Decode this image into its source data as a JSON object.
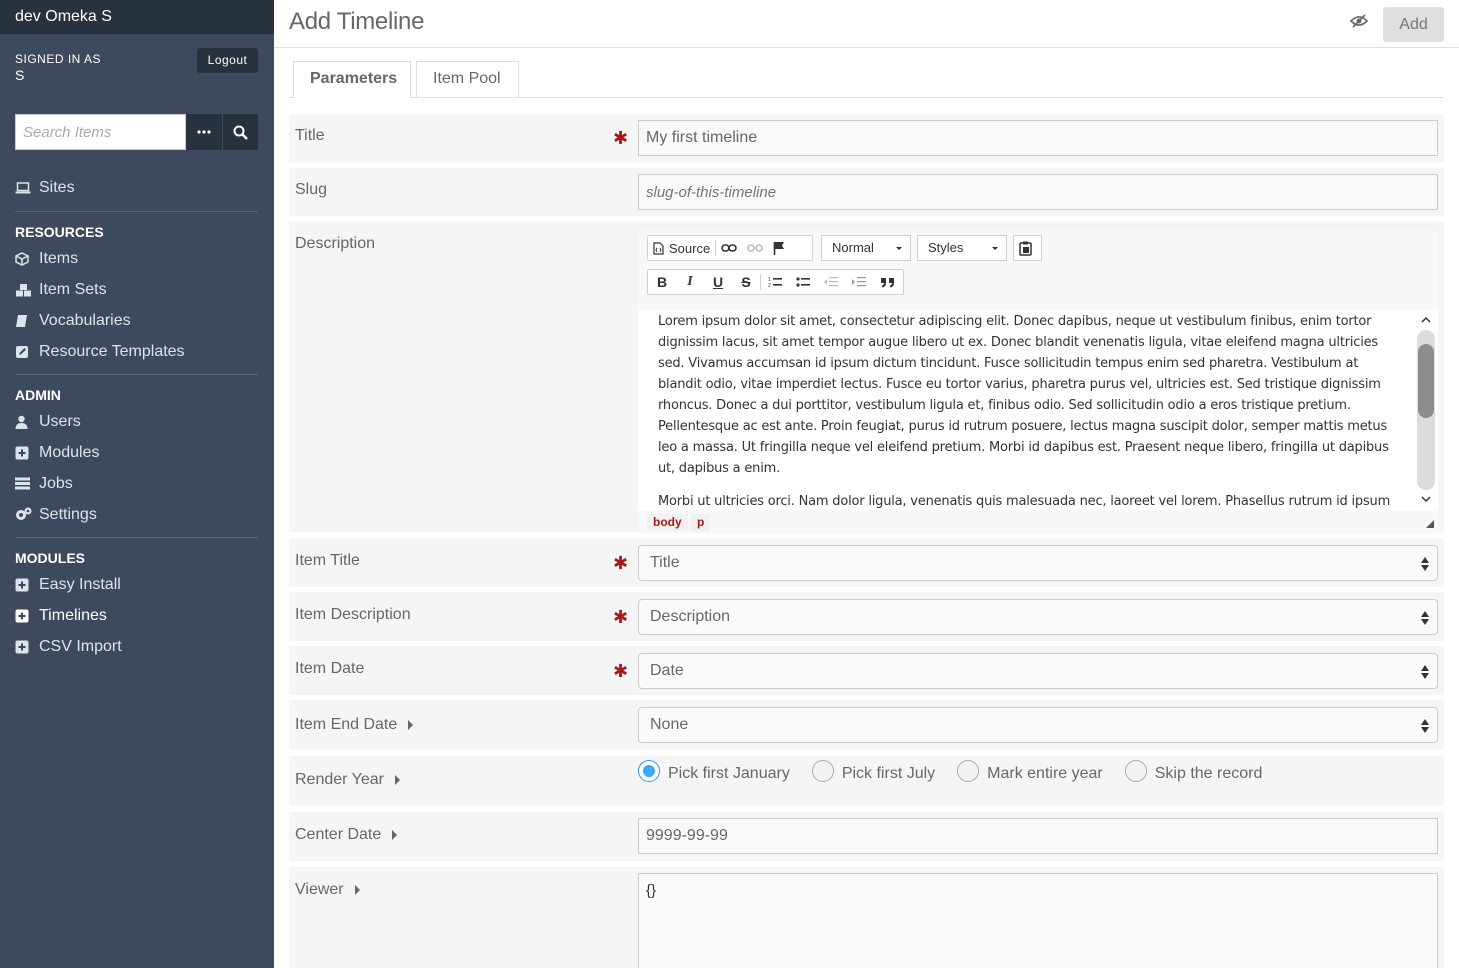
{
  "sidebar": {
    "brand": "dev Omeka S",
    "signed_in_label": "SIGNED IN AS",
    "user": "S",
    "logout": "Logout",
    "search_placeholder": "Search Items",
    "sites": "Sites",
    "groups": [
      {
        "title": "RESOURCES",
        "items": [
          {
            "label": "Items",
            "icon": "cube-icon"
          },
          {
            "label": "Item Sets",
            "icon": "cubes-icon"
          },
          {
            "label": "Vocabularies",
            "icon": "book-icon"
          },
          {
            "label": "Resource Templates",
            "icon": "edit-icon"
          }
        ]
      },
      {
        "title": "ADMIN",
        "items": [
          {
            "label": "Users",
            "icon": "user-icon"
          },
          {
            "label": "Modules",
            "icon": "plus-square-icon"
          },
          {
            "label": "Jobs",
            "icon": "tasks-icon"
          },
          {
            "label": "Settings",
            "icon": "cogs-icon"
          }
        ]
      },
      {
        "title": "MODULES",
        "items": [
          {
            "label": "Easy Install",
            "icon": "plus-square-icon"
          },
          {
            "label": "Timelines",
            "icon": "plus-square-icon",
            "active": true
          },
          {
            "label": "CSV Import",
            "icon": "plus-square-icon"
          }
        ]
      }
    ]
  },
  "header": {
    "title": "Add Timeline",
    "add_label": "Add"
  },
  "tabs": [
    {
      "label": "Parameters",
      "active": true
    },
    {
      "label": "Item Pool",
      "active": false
    }
  ],
  "form": {
    "title": {
      "label": "Title",
      "value": "My first timeline"
    },
    "slug": {
      "label": "Slug",
      "placeholder": "slug-of-this-timeline"
    },
    "description": {
      "label": "Description",
      "toolbar": {
        "source": "Source",
        "format": "Normal",
        "styles": "Styles"
      },
      "paragraphs": [
        "Lorem ipsum dolor sit amet, consectetur adipiscing elit. Donec dapibus, neque ut vestibulum finibus, enim tortor dignissim lacus, sit amet tempor augue libero ut ex. Donec blandit venenatis ligula, vitae eleifend magna ultricies sed. Vivamus accumsan id ipsum dictum tincidunt. Fusce sollicitudin tempus enim sed pharetra. Vestibulum at blandit odio, vitae imperdiet lectus. Fusce eu tortor varius, pharetra purus vel, ultricies est. Sed tristique dignissim rhoncus. Donec a dui porttitor, vestibulum ligula et, finibus odio. Sed sollicitudin odio a eros tristique pretium. Pellentesque ac est ante. Proin feugiat, purus id rutrum posuere, lectus magna suscipit dolor, semper mattis metus leo a massa. Ut fringilla neque vel eleifend pretium. Morbi id dapibus est. Praesent neque libero, fringilla ut dapibus ut, dapibus a enim.",
        "Morbi ut ultricies orci. Nam dolor ligula, venenatis quis malesuada nec, laoreet vel lorem. Phasellus rutrum id ipsum sit amet efficitur. Sed elementum, quam vel lobortis finibus, neque tellus malesuada ex, id sollicitudin quam odio mollis"
      ],
      "path": [
        "body",
        "p"
      ]
    },
    "item_title": {
      "label": "Item Title",
      "value": "Title"
    },
    "item_description": {
      "label": "Item Description",
      "value": "Description"
    },
    "item_date": {
      "label": "Item Date",
      "value": "Date"
    },
    "item_end_date": {
      "label": "Item End Date",
      "value": "None"
    },
    "render_year": {
      "label": "Render Year",
      "options": [
        "Pick first January",
        "Pick first July",
        "Mark entire year",
        "Skip the record"
      ],
      "selected": 0
    },
    "center_date": {
      "label": "Center Date",
      "value": "9999-99-99"
    },
    "viewer": {
      "label": "Viewer",
      "value": "{}"
    }
  },
  "colors": {
    "sidebar_bg": "#3d4a5d",
    "sidebar_dark": "#28313e",
    "required": "#a91919",
    "radio_accent": "#3fa9f5"
  }
}
